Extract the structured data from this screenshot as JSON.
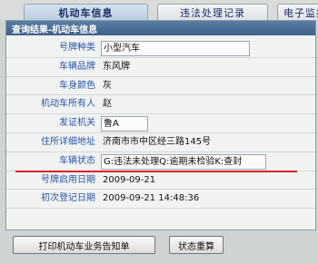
{
  "tabs": [
    {
      "label": "机动车信息"
    },
    {
      "label": "违法处理记录"
    },
    {
      "label": "电子监控"
    }
  ],
  "panel_title": "查询结果-机动车信息",
  "fields": [
    {
      "label": "号牌种类",
      "value": "小型汽车"
    },
    {
      "label": "车辆品牌",
      "value": "东风牌"
    },
    {
      "label": "车身颜色",
      "value": "灰"
    },
    {
      "label": "机动车所有人",
      "value": "赵"
    },
    {
      "label": "发证机关",
      "value": "鲁A"
    },
    {
      "label": "住所详细地址",
      "value": "济南市市中区经三路145号"
    },
    {
      "label": "车辆状态",
      "value": "G:违法未处理Q:逾期未检验K:查封"
    },
    {
      "label": "号牌启用日期",
      "value": "2009-09-21"
    },
    {
      "label": "初次登记日期",
      "value": "2009-09-21 14:48:36"
    }
  ],
  "buttons": {
    "print": "打印机动车业务告知单",
    "status_reset": "状态重算"
  },
  "colors": {
    "label_text": "#2a55a8",
    "title_bar": "#4a6f96",
    "underline": "#d8232a"
  }
}
